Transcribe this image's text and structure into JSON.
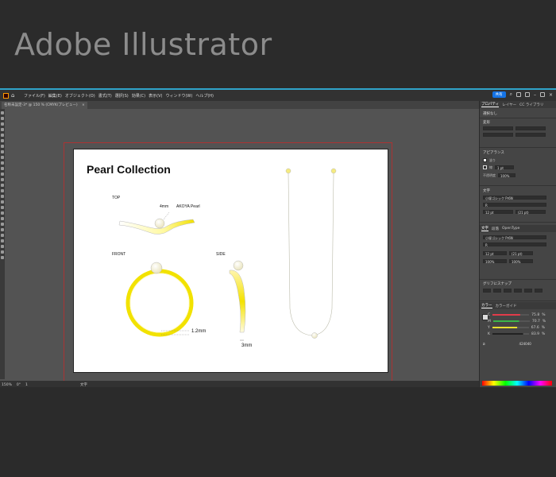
{
  "heading": "Adobe Illustrator",
  "menubar": {
    "items": [
      "ファイル(F)",
      "編集(E)",
      "オブジェクト(O)",
      "書式(T)",
      "選択(S)",
      "効果(C)",
      "表示(V)",
      "ウィンドウ(W)",
      "ヘルプ(H)"
    ],
    "share_label": "共有"
  },
  "document_tab": {
    "label": "名称未設定-3* @ 150 % (CMYK/プレビュー)",
    "close": "×"
  },
  "artboard": {
    "title": "Pearl Collection",
    "label_top": "TOP",
    "label_front": "FRONT",
    "label_side": "SIDE",
    "annotation_4mm": "4mm",
    "annotation_pearl": "AKOYA Pearl",
    "annotation_12mm": "1.2mm",
    "annotation_3mm": "3mm"
  },
  "statusbar": {
    "zoom": "150%",
    "angle": "0°",
    "page": "1",
    "tool": "文字"
  },
  "panel": {
    "tabs": [
      "プロパティ",
      "レイヤー",
      "CC ライブラリ"
    ],
    "no_selection": "選択なし",
    "transform": "変形",
    "appearance": "アピアランス",
    "fill": "塗り",
    "stroke": "線",
    "stroke_width": "1 pt",
    "opacity_label": "不透明度",
    "opacity": "100%",
    "character": "文字",
    "font_name": "小塚ゴシック Pr6N",
    "font_style": "R",
    "font_size": "12 pt",
    "leading": "(21 pt)",
    "scale": "100%",
    "char_tabs": [
      "文字",
      "段落",
      "OpenType"
    ],
    "glyph_snap": "グリフにスナップ",
    "color_tabs": [
      "カラー",
      "カラーガイド"
    ],
    "color_values": [
      {
        "channel": "C",
        "value": "75.8",
        "unit": "%",
        "color": "#e23b4a",
        "level": 0.758
      },
      {
        "channel": "M",
        "value": "70.7",
        "unit": "%",
        "color": "#3bb54a",
        "level": 0.707
      },
      {
        "channel": "Y",
        "value": "67.6",
        "unit": "%",
        "color": "#e8e030",
        "level": 0.676
      },
      {
        "channel": "K",
        "value": "83.9",
        "unit": "%",
        "color": "#222222",
        "level": 0.839
      }
    ],
    "hex": "424040"
  }
}
